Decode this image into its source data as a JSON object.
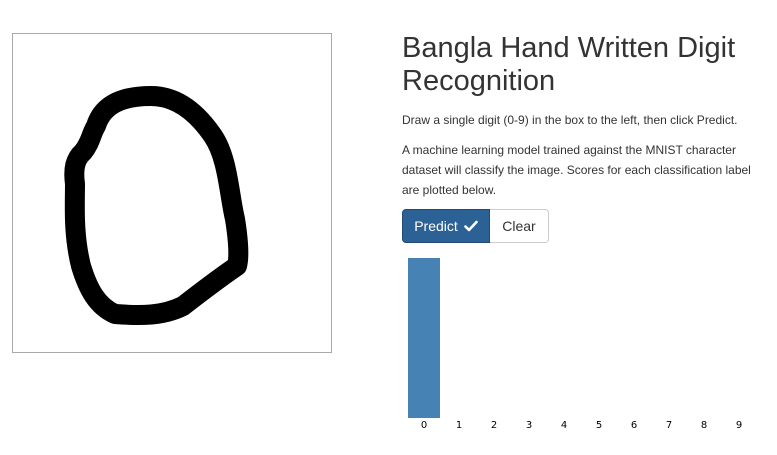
{
  "heading": {
    "title": "Bangla Hand Written Digit Recognition"
  },
  "instructions": {
    "line1": "Draw a single digit (0-9) in the box to the left, then click Predict.",
    "line2": "A machine learning model trained against the MNIST character dataset will classify the image. Scores for each classification label are plotted below."
  },
  "buttons": {
    "predict_label": "Predict",
    "predict_icon": "checkmark-icon",
    "clear_label": "Clear"
  },
  "colors": {
    "bar": "#4682b4",
    "predict_button": "#2c6196",
    "stroke": "#000000"
  },
  "chart_data": {
    "type": "bar",
    "categories": [
      "0",
      "1",
      "2",
      "3",
      "4",
      "5",
      "6",
      "7",
      "8",
      "9"
    ],
    "values": [
      1,
      0,
      0,
      0,
      0,
      0,
      0,
      0,
      0,
      0
    ],
    "ylim": [
      0,
      1
    ],
    "title": "",
    "xlabel": "",
    "ylabel": "",
    "grid": false
  }
}
